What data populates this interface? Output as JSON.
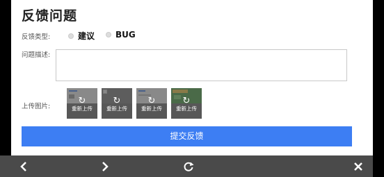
{
  "page": {
    "title": "反馈问题"
  },
  "form": {
    "type_label": "反馈类型:",
    "options": [
      "建议",
      "BUG"
    ],
    "desc_label": "问题描述:",
    "upload_label": "上传图片:",
    "reupload_label": "重新上传",
    "submit_label": "提交反馈"
  },
  "icons": {
    "back": "chevron-left-icon",
    "forward": "chevron-right-icon",
    "refresh": "refresh-icon",
    "close": "close-icon"
  },
  "colors": {
    "accent": "#3d7ef3",
    "toolbar": "#4a4a4a"
  }
}
